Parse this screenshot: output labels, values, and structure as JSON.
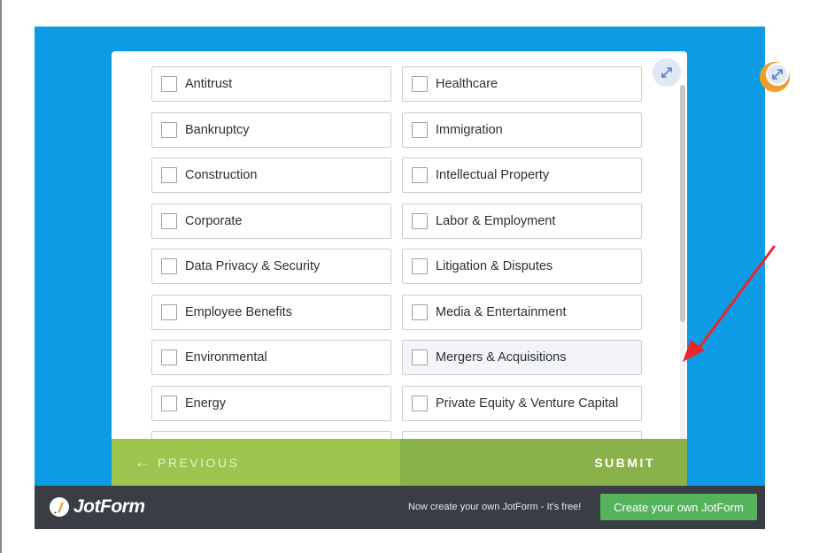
{
  "form": {
    "options_left": [
      "Antitrust",
      "Bankruptcy",
      "Construction",
      "Corporate",
      "Data Privacy & Security",
      "Employee Benefits",
      "Environmental",
      "Energy"
    ],
    "options_right": [
      "Healthcare",
      "Immigration",
      "Intellectual Property",
      "Labor & Employment",
      "Litigation & Disputes",
      "Media & Entertainment",
      "Mergers & Acquisitions",
      "Private Equity & Venture Capital"
    ],
    "previous_label": "PREVIOUS",
    "previous_arrow": "←",
    "submit_label": "SUBMIT"
  },
  "footer": {
    "brand": "JotForm",
    "promo_text": "Now create your own JotForm - It's free!",
    "create_button": "Create your own JotForm"
  },
  "colors": {
    "stage_bg": "#0d9be5",
    "prev_bg": "#9cc44f",
    "submit_bg": "#89b24a",
    "footer_bg": "#3a3d44",
    "create_bg": "#55b35c",
    "annotation_arrow": "#e8262b"
  },
  "icons": [
    "expand-icon",
    "avatar-icon",
    "jotform-logo-icon",
    "annotation-arrow-icon"
  ]
}
